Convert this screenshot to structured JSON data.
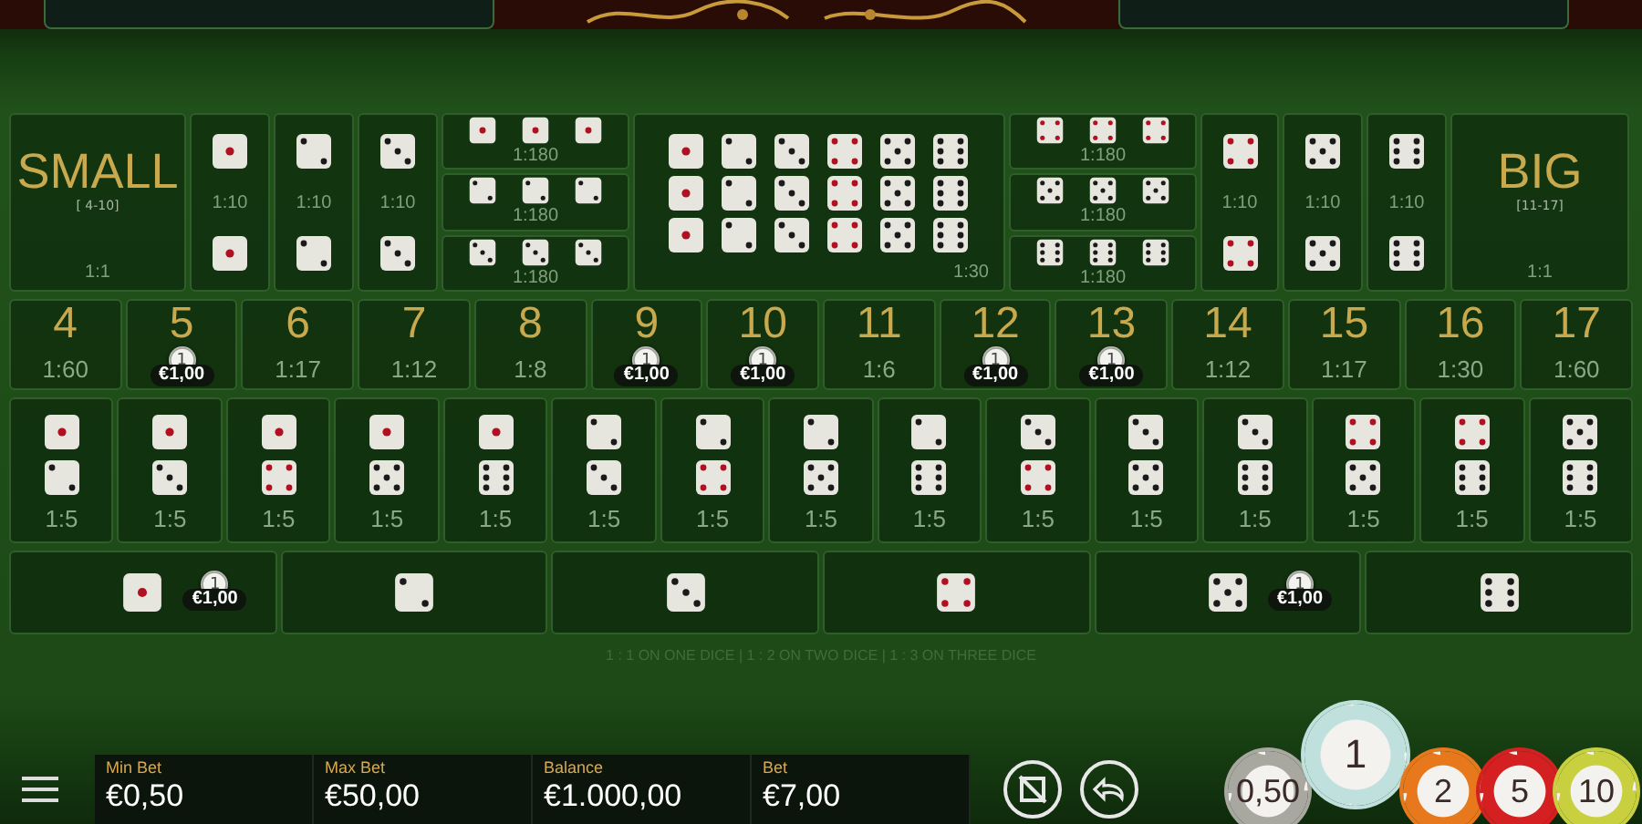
{
  "top_row": [
    {
      "kind": "small",
      "title": "SMALL",
      "range": "[ 4-10]",
      "payout": "1:1"
    },
    {
      "kind": "double",
      "dice": [
        {
          "kind": "one"
        },
        {
          "kind": "one"
        }
      ],
      "payout": "1:10"
    },
    {
      "kind": "double",
      "dice": [
        {
          "kind": "two"
        },
        {
          "kind": "two"
        }
      ],
      "payout": "1:10"
    },
    {
      "kind": "double",
      "dice": [
        {
          "kind": "three"
        },
        {
          "kind": "three"
        }
      ],
      "payout": "1:10"
    },
    {
      "kind": "triple_stack",
      "rows": [
        {
          "dice": [
            {
              "kind": "one"
            },
            {
              "kind": "one"
            },
            {
              "kind": "one"
            }
          ],
          "payout": "1:180"
        },
        {
          "dice": [
            {
              "kind": "two"
            },
            {
              "kind": "two"
            },
            {
              "kind": "two"
            }
          ],
          "payout": "1:180"
        },
        {
          "dice": [
            {
              "kind": "three"
            },
            {
              "kind": "three"
            },
            {
              "kind": "three"
            }
          ],
          "payout": "1:180"
        }
      ]
    },
    {
      "kind": "any_triple",
      "rows": [
        [
          {
            "kind": "one"
          },
          {
            "kind": "two"
          },
          {
            "kind": "three"
          },
          {
            "kind": "four"
          },
          {
            "kind": "five"
          },
          {
            "kind": "six"
          }
        ],
        [
          {
            "kind": "one"
          },
          {
            "kind": "two"
          },
          {
            "kind": "three"
          },
          {
            "kind": "four"
          },
          {
            "kind": "five"
          },
          {
            "kind": "six"
          }
        ],
        [
          {
            "kind": "one"
          },
          {
            "kind": "two"
          },
          {
            "kind": "three"
          },
          {
            "kind": "four"
          },
          {
            "kind": "five"
          },
          {
            "kind": "six"
          }
        ]
      ],
      "payout": "1:30"
    },
    {
      "kind": "triple_stack",
      "rows": [
        {
          "dice": [
            {
              "kind": "four"
            },
            {
              "kind": "four"
            },
            {
              "kind": "four"
            }
          ],
          "payout": "1:180"
        },
        {
          "dice": [
            {
              "kind": "five"
            },
            {
              "kind": "five"
            },
            {
              "kind": "five"
            }
          ],
          "payout": "1:180"
        },
        {
          "dice": [
            {
              "kind": "six"
            },
            {
              "kind": "six"
            },
            {
              "kind": "six"
            }
          ],
          "payout": "1:180"
        }
      ]
    },
    {
      "kind": "double",
      "dice": [
        {
          "kind": "four"
        },
        {
          "kind": "four"
        }
      ],
      "payout": "1:10"
    },
    {
      "kind": "double",
      "dice": [
        {
          "kind": "five"
        },
        {
          "kind": "five"
        }
      ],
      "payout": "1:10"
    },
    {
      "kind": "double",
      "dice": [
        {
          "kind": "six"
        },
        {
          "kind": "six"
        }
      ],
      "payout": "1:10"
    },
    {
      "kind": "big",
      "title": "BIG",
      "range": "[11-17]",
      "payout": "1:1"
    }
  ],
  "totals": [
    {
      "total": "4",
      "payout": "1:60"
    },
    {
      "total": "5",
      "bet": {
        "chip": "1",
        "amount": "€1,00"
      }
    },
    {
      "total": "6",
      "payout": "1:17"
    },
    {
      "total": "7",
      "payout": "1:12"
    },
    {
      "total": "8",
      "payout": "1:8"
    },
    {
      "total": "9",
      "bet": {
        "chip": "1",
        "amount": "€1,00"
      }
    },
    {
      "total": "10",
      "bet": {
        "chip": "1",
        "amount": "€1,00"
      }
    },
    {
      "total": "11",
      "payout": "1:6"
    },
    {
      "total": "12",
      "bet": {
        "chip": "1",
        "amount": "€1,00"
      }
    },
    {
      "total": "13",
      "bet": {
        "chip": "1",
        "amount": "€1,00"
      }
    },
    {
      "total": "14",
      "payout": "1:12"
    },
    {
      "total": "15",
      "payout": "1:17"
    },
    {
      "total": "16",
      "payout": "1:30"
    },
    {
      "total": "17",
      "payout": "1:60"
    }
  ],
  "combinations": [
    {
      "dice": [
        {
          "kind": "one"
        },
        {
          "kind": "two"
        }
      ],
      "payout": "1:5"
    },
    {
      "dice": [
        {
          "kind": "one"
        },
        {
          "kind": "three"
        }
      ],
      "payout": "1:5"
    },
    {
      "dice": [
        {
          "kind": "one"
        },
        {
          "kind": "four"
        }
      ],
      "payout": "1:5"
    },
    {
      "dice": [
        {
          "kind": "one"
        },
        {
          "kind": "five"
        }
      ],
      "payout": "1:5"
    },
    {
      "dice": [
        {
          "kind": "one"
        },
        {
          "kind": "six"
        }
      ],
      "payout": "1:5"
    },
    {
      "dice": [
        {
          "kind": "two"
        },
        {
          "kind": "three"
        }
      ],
      "payout": "1:5"
    },
    {
      "dice": [
        {
          "kind": "two"
        },
        {
          "kind": "four"
        }
      ],
      "payout": "1:5"
    },
    {
      "dice": [
        {
          "kind": "two"
        },
        {
          "kind": "five"
        }
      ],
      "payout": "1:5"
    },
    {
      "dice": [
        {
          "kind": "two"
        },
        {
          "kind": "six"
        }
      ],
      "payout": "1:5"
    },
    {
      "dice": [
        {
          "kind": "three"
        },
        {
          "kind": "four"
        }
      ],
      "payout": "1:5"
    },
    {
      "dice": [
        {
          "kind": "three"
        },
        {
          "kind": "five"
        }
      ],
      "payout": "1:5"
    },
    {
      "dice": [
        {
          "kind": "three"
        },
        {
          "kind": "six"
        }
      ],
      "payout": "1:5"
    },
    {
      "dice": [
        {
          "kind": "four"
        },
        {
          "kind": "five"
        }
      ],
      "payout": "1:5"
    },
    {
      "dice": [
        {
          "kind": "four"
        },
        {
          "kind": "six"
        }
      ],
      "payout": "1:5"
    },
    {
      "dice": [
        {
          "kind": "five"
        },
        {
          "kind": "six"
        }
      ],
      "payout": "1:5"
    }
  ],
  "singles": [
    {
      "die": {
        "kind": "one"
      },
      "bet": {
        "chip": "1",
        "amount": "€1,00"
      }
    },
    {
      "die": {
        "kind": "two"
      }
    },
    {
      "die": {
        "kind": "three"
      }
    },
    {
      "die": {
        "kind": "four"
      }
    },
    {
      "die": {
        "kind": "five"
      },
      "bet": {
        "chip": "1",
        "amount": "€1,00"
      }
    },
    {
      "die": {
        "kind": "six"
      }
    }
  ],
  "singles_note": "1 : 1 ON ONE DICE | 1 : 2 ON TWO DICE | 1 : 3 ON THREE DICE",
  "bottom_bar": {
    "stats": [
      {
        "label": "Min Bet",
        "value": "€0,50"
      },
      {
        "label": "Max Bet",
        "value": "€50,00"
      },
      {
        "label": "Balance",
        "value": "€1.000,00"
      },
      {
        "label": "Bet",
        "value": "€7,00"
      }
    ],
    "chips": [
      {
        "label": "0,50",
        "color": "#a8a8a0",
        "selected": false
      },
      {
        "label": "1",
        "color": "#bfe0dc",
        "selected": true
      },
      {
        "label": "2",
        "color": "#e8781c",
        "selected": false
      },
      {
        "label": "5",
        "color": "#d42020",
        "selected": false
      },
      {
        "label": "10",
        "color": "#c8d040",
        "selected": false
      }
    ]
  }
}
